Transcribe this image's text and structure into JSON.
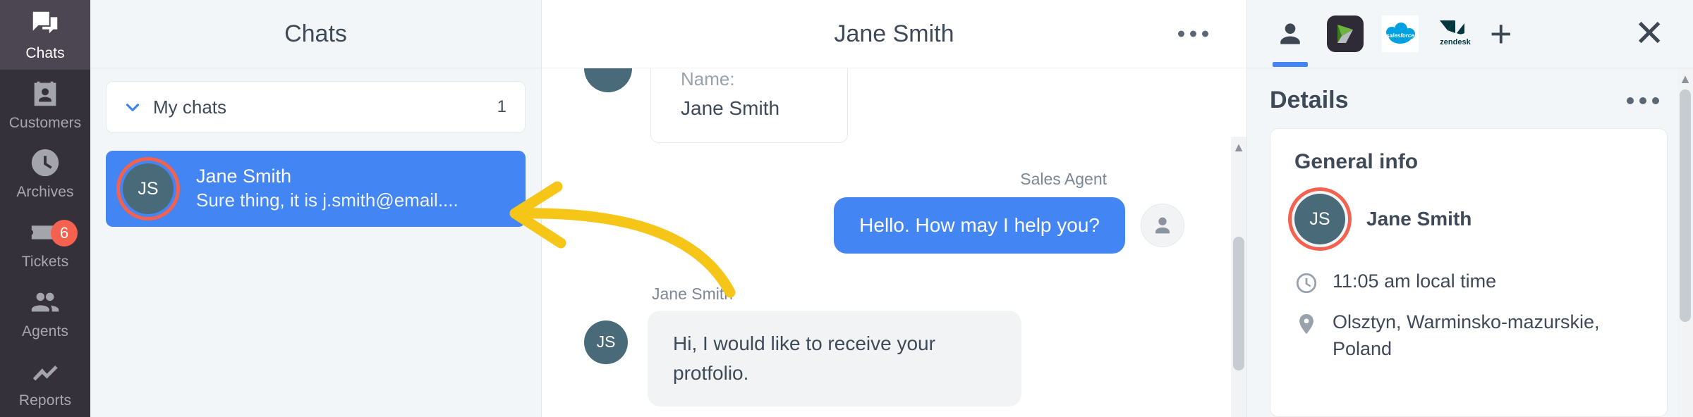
{
  "nav": {
    "items": [
      {
        "label": "Chats",
        "icon": "chats-icon",
        "active": true,
        "badge": ""
      },
      {
        "label": "Customers",
        "icon": "customers-icon",
        "active": false,
        "badge": ""
      },
      {
        "label": "Archives",
        "icon": "archives-icon",
        "active": false,
        "badge": ""
      },
      {
        "label": "Tickets",
        "icon": "tickets-icon",
        "active": false,
        "badge": "6"
      },
      {
        "label": "Agents",
        "icon": "agents-icon",
        "active": false,
        "badge": ""
      },
      {
        "label": "Reports",
        "icon": "reports-icon",
        "active": false,
        "badge": ""
      }
    ]
  },
  "chatlist": {
    "title": "Chats",
    "group": {
      "label": "My chats",
      "count": "1",
      "expanded": true
    },
    "items": [
      {
        "name": "Jane Smith",
        "preview": "Sure thing, it is j.smith@email....",
        "initials": "JS",
        "selected": true
      }
    ]
  },
  "conversation": {
    "title": "Jane Smith",
    "info_card": {
      "key": "Name:",
      "value": "Jane Smith"
    },
    "messages": [
      {
        "author": "Sales Agent",
        "side": "right",
        "text": "Hello. How may I help you?"
      },
      {
        "author": "Jane Smith",
        "side": "left",
        "initials": "JS",
        "text": "Hi, I would like to receive your protfolio."
      }
    ]
  },
  "details": {
    "tabs": [
      {
        "name": "customer-profile-tab",
        "label": "Customer profile",
        "selected": true
      },
      {
        "name": "livechat-app-tab",
        "label": "LiveChat",
        "selected": false
      },
      {
        "name": "salesforce-app-tab",
        "label": "salesforce",
        "selected": false
      },
      {
        "name": "zendesk-app-tab",
        "label": "zendesk",
        "selected": false
      }
    ],
    "add_label": "+",
    "close_label": "✕",
    "title": "Details",
    "general": {
      "heading": "General info",
      "person": {
        "name": "Jane Smith",
        "initials": "JS"
      },
      "time": "11:05 am local time",
      "location": "Olsztyn, Warminsko-mazurskie, Poland"
    }
  },
  "colors": {
    "accent": "#4485f4",
    "nav_bg": "#35313b",
    "badge": "#f4624f",
    "avatar": "#496a78",
    "annotation": "#f5c518"
  }
}
